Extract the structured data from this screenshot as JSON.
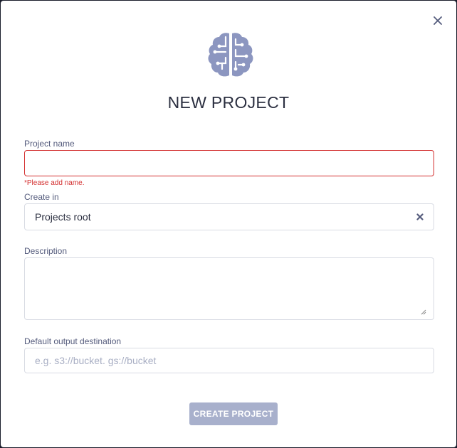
{
  "dialog": {
    "title": "NEW PROJECT",
    "close_icon": "close-icon",
    "logo_icon": "brain-circuit-icon"
  },
  "form": {
    "project_name": {
      "label": "Project name",
      "value": "",
      "placeholder": "",
      "error": "*Please add name."
    },
    "create_in": {
      "label": "Create in",
      "value": "Projects root",
      "clear_icon": "clear-icon"
    },
    "description": {
      "label": "Description",
      "value": ""
    },
    "output_destination": {
      "label": "Default output destination",
      "placeholder": "e.g. s3://bucket. gs://bucket",
      "value": ""
    }
  },
  "actions": {
    "create_label": "CREATE PROJECT"
  },
  "colors": {
    "accent": "#8c96c0",
    "error": "#d32f2f",
    "button_disabled": "#a8b0cc"
  }
}
